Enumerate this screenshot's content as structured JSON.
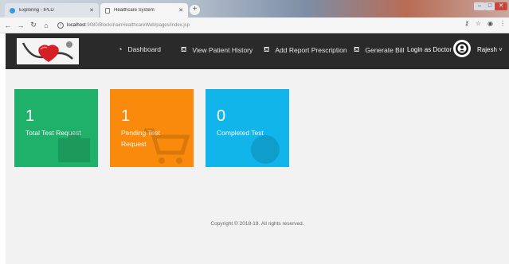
{
  "browser": {
    "tabs": [
      {
        "title": "Exploring - IPLD",
        "active": false
      },
      {
        "title": "Healthcare System",
        "active": true
      }
    ],
    "address": {
      "host": "localhost",
      "path": ":9080/BlockchainHealthcareWeb/pages/index.jsp"
    }
  },
  "navbar": {
    "items": [
      {
        "label": "Dashboard",
        "icon": "dashboard-icon"
      },
      {
        "label": "View Patient History",
        "icon": "basket-icon"
      },
      {
        "label": "Add Report Prescription",
        "icon": "basket-icon"
      },
      {
        "label": "Generate Bill",
        "icon": "basket-icon"
      }
    ],
    "login_label": "Login as Doctor",
    "user_name": "Rajesh"
  },
  "cards": [
    {
      "count": "1",
      "label": "Total Test Request",
      "color": "#1fb06a"
    },
    {
      "count": "1",
      "label": "Pending Test Request",
      "color": "#f98a0c"
    },
    {
      "count": "0",
      "label": "Completed Test",
      "color": "#12b5ea"
    }
  ],
  "footer": {
    "text": "Copyright © 2018-19. All rights reserved."
  }
}
